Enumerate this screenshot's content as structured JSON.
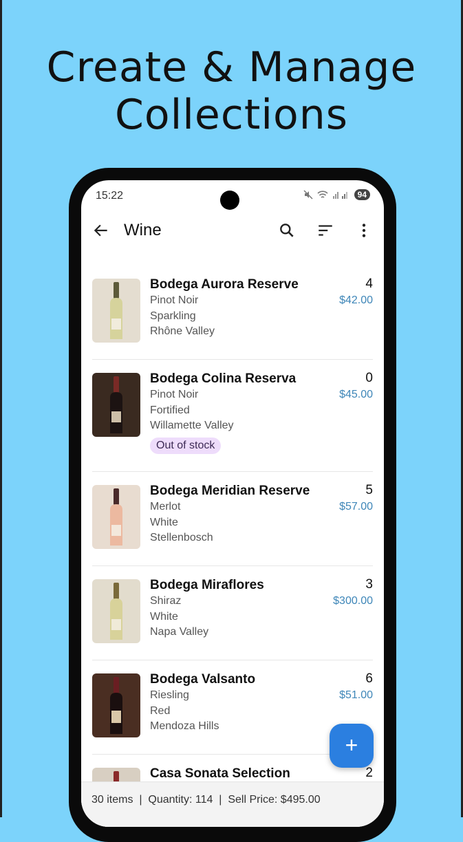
{
  "headline": {
    "line1": "Create & Manage",
    "line2": "Collections"
  },
  "status_bar": {
    "time": "15:22",
    "battery": "94"
  },
  "app_bar": {
    "title": "Wine"
  },
  "items": [
    {
      "name": "Bodega Aurora Reserve",
      "grape": "Pinot Noir",
      "style": "Sparkling",
      "region": "Rhône Valley",
      "qty": "4",
      "price": "$42.00",
      "badge": ""
    },
    {
      "name": "Bodega Colina Reserva",
      "grape": "Pinot Noir",
      "style": "Fortified",
      "region": "Willamette Valley",
      "qty": "0",
      "price": "$45.00",
      "badge": "Out of stock"
    },
    {
      "name": "Bodega Meridian Reserve",
      "grape": "Merlot",
      "style": "White",
      "region": "Stellenbosch",
      "qty": "5",
      "price": "$57.00",
      "badge": ""
    },
    {
      "name": "Bodega Miraflores",
      "grape": "Shiraz",
      "style": "White",
      "region": "Napa Valley",
      "qty": "3",
      "price": "$300.00",
      "badge": ""
    },
    {
      "name": "Bodega Valsanto",
      "grape": "Riesling",
      "style": "Red",
      "region": "Mendoza Hills",
      "qty": "6",
      "price": "$51.00",
      "badge": ""
    },
    {
      "name": "Casa Sonata Selection",
      "grape": "",
      "style": "",
      "region": "",
      "qty": "2",
      "price": "",
      "badge": ""
    }
  ],
  "fab": {
    "label": "+"
  },
  "footer": {
    "summary": "30 items  |  Quantity: 114  |  Sell Price: $495.00"
  },
  "colors": {
    "background": "#7cd3fb",
    "accent": "#2b7fe0",
    "price": "#3e86b8",
    "badge_bg": "#eedcfb"
  },
  "icons": [
    "back-arrow-icon",
    "search-icon",
    "sort-icon",
    "more-vert-icon",
    "wifi-icon",
    "signal-icon",
    "mute-icon",
    "bottle-icon",
    "plus-icon"
  ]
}
